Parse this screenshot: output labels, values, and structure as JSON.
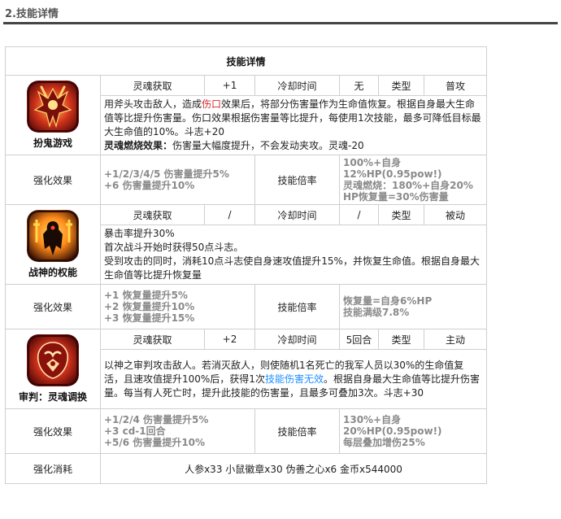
{
  "section": {
    "title": "2.技能详情"
  },
  "table": {
    "title": "技能详情"
  },
  "headers": {
    "soul_gain": "灵魂获取",
    "cooldown": "冷却时间",
    "type": "类型"
  },
  "labels": {
    "enhance": "强化效果",
    "multiplier": "技能倍率",
    "cost": "强化消耗"
  },
  "skills": [
    {
      "name": "扮鬼游戏",
      "icon": "horned-warrior-icon",
      "soul_gain": "+1",
      "cooldown": "无",
      "type": "普攻",
      "desc": {
        "p1": "用斧头攻击敌人，造成",
        "p2": "伤口",
        "p3": "效果后，将部分伤害量作为生命值恢复。根据自身最大生命值等比提升伤害量。伤口效果根据伤害量等比提升，每使用1次技能，最多可降低目标最大生命值的10%。斗志+20",
        "p4_label": "灵魂燃烧效果：",
        "p4_text": "伤害量大幅度提升，不会发动夹攻。灵魂-20"
      },
      "enhance": [
        "+1/2/3/4/5 伤害量提升5%",
        "+6 伤害量提升10%"
      ],
      "multiplier": [
        "100%+自身12%HP(0.95pow!)",
        "灵魂燃烧：180%+自身20%",
        "HP恢复量=30%伤害量"
      ]
    },
    {
      "name": "战神的权能",
      "icon": "war-god-icon",
      "soul_gain": "/",
      "cooldown": "/",
      "type": "被动",
      "desc": {
        "l1": "暴击率提升30%",
        "l2": "首次战斗开始时获得50点斗志。",
        "l3": "受到攻击的同时，消耗10点斗志使自身速攻值提升15%，并恢复生命值。根据自身最大生命值等比提升恢复量"
      },
      "enhance": [
        "+1 恢复量提升5%",
        "+2 恢复量提升10%",
        "+3 恢复量提升15%"
      ],
      "multiplier": [
        "恢复量=自身6%HP",
        "技能满级7.8%"
      ]
    },
    {
      "name": "审判：灵魂调换",
      "icon": "judgment-soul-icon",
      "soul_gain": "+2",
      "cooldown": "5回合",
      "type": "主动",
      "desc": {
        "p1": "以神之审判攻击敌人。若消灭敌人，则使随机1名死亡的我军人员以30%的生命值复活，且速攻值提升100%后，获得1次",
        "p2": "技能伤害无效",
        "p3": "。根据自身最大生命值等比提升伤害量。每当有人死亡时，提升此技能的伤害量，且最多可叠加3次。斗志+30"
      },
      "enhance": [
        "+1/2/4 伤害量提升5%",
        "+3 cd-1回合",
        "+5/6 伤害量提升10%"
      ],
      "multiplier": [
        "130%+自身20%HP(0.95pow!)",
        "每层叠加增伤25%"
      ]
    }
  ],
  "cost": "人参x33  小鼠徽章x30 伪善之心x6 金币x544000"
}
